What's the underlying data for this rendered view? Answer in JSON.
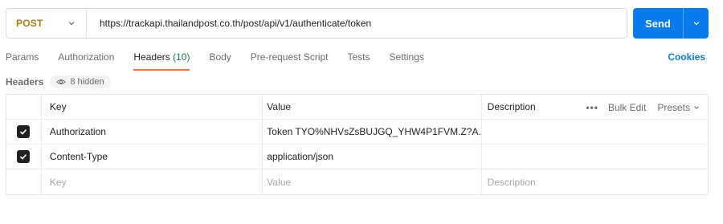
{
  "request": {
    "method": "POST",
    "url": "https://trackapi.thailandpost.co.th/post/api/v1/authenticate/token",
    "send_label": "Send"
  },
  "tabs": [
    {
      "label": "Params"
    },
    {
      "label": "Authorization"
    },
    {
      "label": "Headers",
      "count": "(10)",
      "active": true
    },
    {
      "label": "Body"
    },
    {
      "label": "Pre-request Script"
    },
    {
      "label": "Tests"
    },
    {
      "label": "Settings"
    }
  ],
  "cookies_label": "Cookies",
  "headers_section": {
    "title": "Headers",
    "hidden_label": "8 hidden"
  },
  "table": {
    "columns": {
      "key": "Key",
      "value": "Value",
      "description": "Description"
    },
    "actions": {
      "dots": "•••",
      "bulk_edit": "Bulk Edit",
      "presets": "Presets"
    },
    "rows": [
      {
        "checked": true,
        "key": "Authorization",
        "value": "Token TYO%NHVsZsBUJGQ_YHW4P1FVM.Z?A...",
        "description": ""
      },
      {
        "checked": true,
        "key": "Content-Type",
        "value": "application/json",
        "description": ""
      }
    ],
    "placeholder": {
      "key": "Key",
      "value": "Value",
      "description": "Description"
    }
  },
  "colors": {
    "method": "#ad7a03",
    "send": "#097bed",
    "active_tab_underline": "#ff6c37",
    "count": "#0f7a3b",
    "link": "#097bed"
  }
}
